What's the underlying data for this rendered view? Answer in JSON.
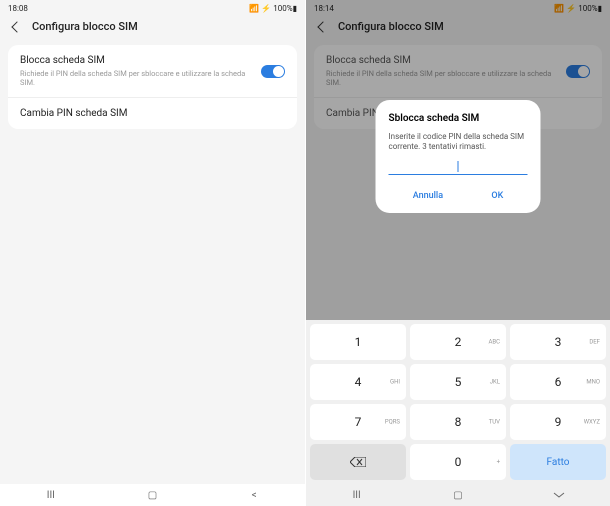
{
  "left": {
    "status": {
      "time": "18:08",
      "icons": "📷 ∞ ···",
      "signal": "📶 ⚡ 100%▮"
    },
    "title": "Configura blocco SIM",
    "rows": {
      "lock": {
        "title": "Blocca scheda SIM",
        "sub": "Richiede il PIN della scheda SIM per sbloccare e utilizzare la scheda SIM."
      },
      "change": {
        "title": "Cambia PIN scheda SIM"
      }
    }
  },
  "right": {
    "status": {
      "time": "18:14",
      "icons": "📷 ∞ ···",
      "signal": "📶 ⚡ 100%▮"
    },
    "title": "Configura blocco SIM",
    "rows": {
      "lock": {
        "title": "Blocca scheda SIM",
        "sub": "Richiede il PIN della scheda SIM per sbloccare e utilizzare la scheda SIM."
      },
      "change": {
        "title": "Cambia PIN scheda SIM"
      }
    },
    "dialog": {
      "title": "Sblocca scheda SIM",
      "msg": "Inserite il codice PIN della scheda SIM corrente. 3 tentativi rimasti.",
      "cancel": "Annulla",
      "ok": "OK"
    },
    "keypad": {
      "k1": {
        "n": "1",
        "s": ""
      },
      "k2": {
        "n": "2",
        "s": "ABC"
      },
      "k3": {
        "n": "3",
        "s": "DEF"
      },
      "k4": {
        "n": "4",
        "s": "GHI"
      },
      "k5": {
        "n": "5",
        "s": "JKL"
      },
      "k6": {
        "n": "6",
        "s": "MNO"
      },
      "k7": {
        "n": "7",
        "s": "PQRS"
      },
      "k8": {
        "n": "8",
        "s": "TUV"
      },
      "k9": {
        "n": "9",
        "s": "WXYZ"
      },
      "k0": {
        "n": "0",
        "s": "+"
      },
      "done": "Fatto"
    }
  }
}
